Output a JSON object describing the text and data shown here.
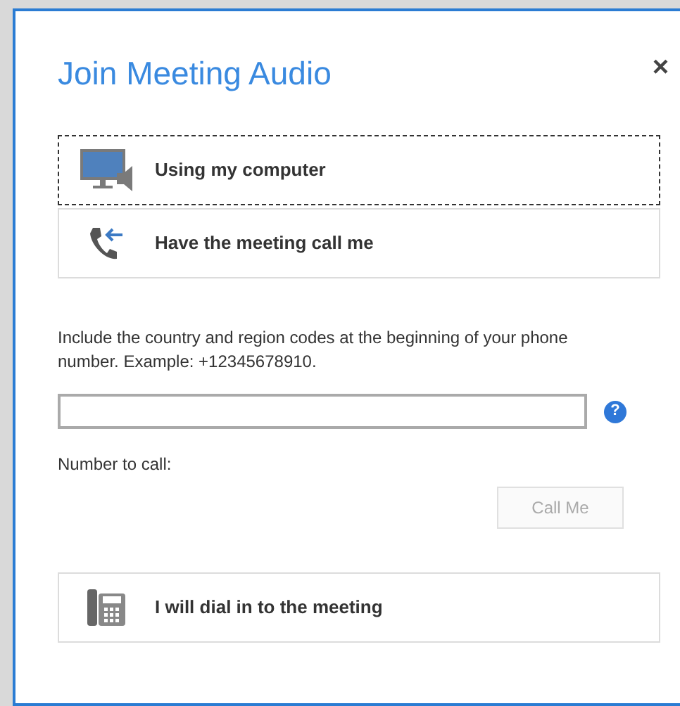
{
  "dialog": {
    "title": "Join Meeting Audio",
    "close": "×"
  },
  "options": [
    {
      "kind": "computer",
      "label": "Using my computer",
      "selected": true
    },
    {
      "kind": "callback",
      "label": "Have the meeting call me",
      "selected": false
    }
  ],
  "instructions": "Include the country and region codes at the beginning of your phone number. Example: +12345678910.",
  "help": "?",
  "number_label": "Number to call:",
  "call_button": {
    "label": "Call Me",
    "disabled": true
  },
  "dial_in": {
    "kind": "deskphone",
    "label": "I will dial in to the meeting",
    "selected": false
  }
}
